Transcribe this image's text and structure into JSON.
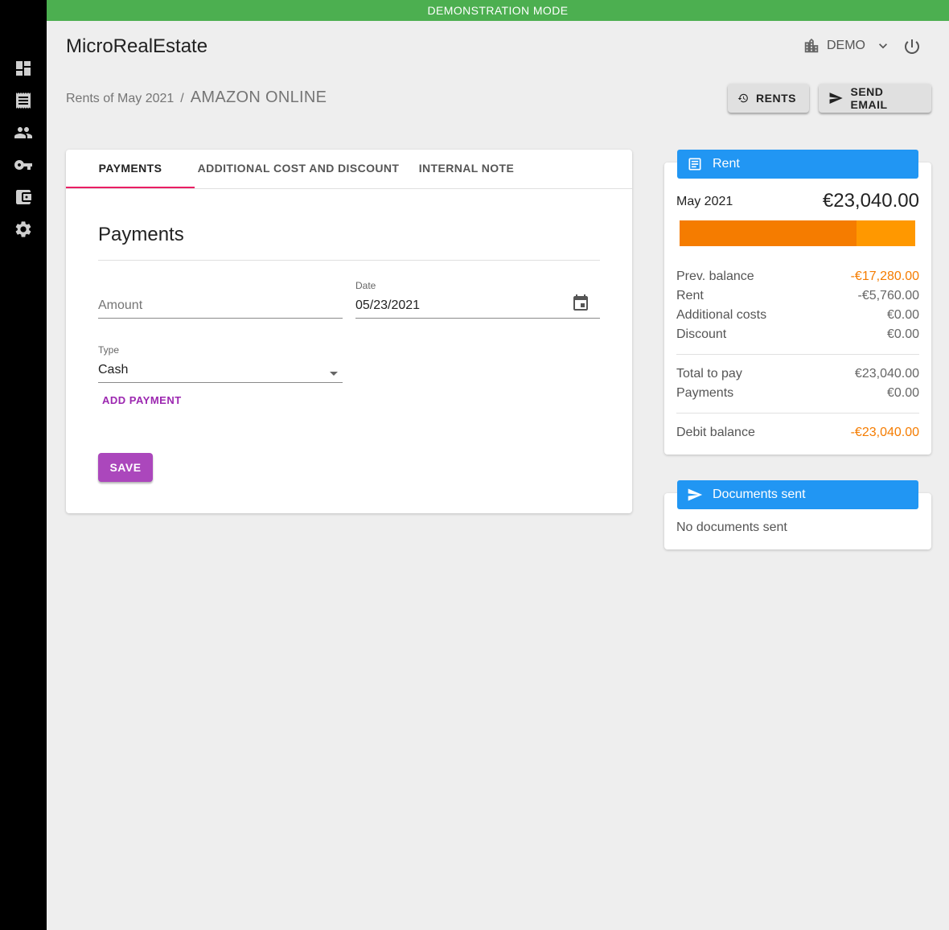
{
  "banner": "DEMONSTRATION MODE",
  "app_title": "MicroRealEstate",
  "org": {
    "name": "DEMO"
  },
  "breadcrumb": {
    "parent": "Rents of May 2021",
    "separator": "/",
    "current": "AMAZON ONLINE"
  },
  "toolbar": {
    "rents_label": "RENTS",
    "send_email_label": "SEND EMAIL"
  },
  "tabs": [
    {
      "label": "PAYMENTS"
    },
    {
      "label": "ADDITIONAL COST AND DISCOUNT"
    },
    {
      "label": "INTERNAL NOTE"
    }
  ],
  "payments_form": {
    "title": "Payments",
    "amount": {
      "placeholder": "Amount",
      "value": ""
    },
    "date": {
      "label": "Date",
      "value": "05/23/2021"
    },
    "type": {
      "label": "Type",
      "value": "Cash"
    },
    "add_payment_label": "ADD PAYMENT",
    "save_label": "SAVE"
  },
  "rent_card": {
    "header": "Rent",
    "month": "May 2021",
    "total": "€23,040.00",
    "progress": {
      "darker_share": 0.75
    },
    "rows": [
      {
        "label": "Prev. balance",
        "value": "-€17,280.00"
      },
      {
        "label": "Rent",
        "value": "-€5,760.00"
      },
      {
        "label": "Additional costs",
        "value": "€0.00"
      },
      {
        "label": "Discount",
        "value": "€0.00"
      },
      {
        "label": "Total to pay",
        "value": "€23,040.00"
      },
      {
        "label": "Payments",
        "value": "€0.00"
      },
      {
        "label": "Debit balance",
        "value": "-€23,040.00"
      }
    ]
  },
  "documents_card": {
    "header": "Documents sent",
    "empty_text": "No documents sent"
  },
  "colors": {
    "banner": "#4caf50",
    "card_header": "#2196f3",
    "accent": "#9c27b0",
    "tab_indicator": "#e91e63",
    "warning": "#f57c00",
    "progress_light": "#ff9800"
  },
  "sidebar": {
    "items": [
      {
        "icon": "dashboard-icon"
      },
      {
        "icon": "receipt-icon"
      },
      {
        "icon": "people-icon"
      },
      {
        "icon": "key-icon"
      },
      {
        "icon": "wallet-icon"
      },
      {
        "icon": "settings-icon"
      }
    ]
  }
}
